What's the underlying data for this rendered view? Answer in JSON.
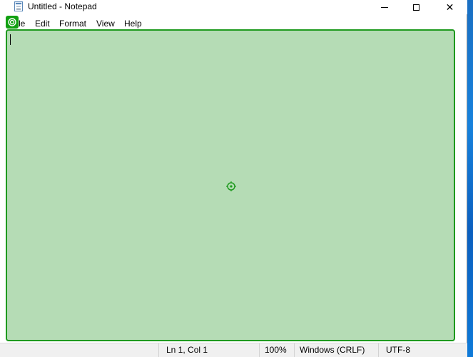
{
  "window": {
    "title": "Untitled - Notepad",
    "icon": "notepad-icon"
  },
  "caption_buttons": {
    "minimize": "minimize-icon",
    "maximize": "maximize-icon",
    "close": "close-icon",
    "close_glyph": "✕"
  },
  "menu": {
    "file": "le",
    "edit": "Edit",
    "format": "Format",
    "view": "View",
    "help": "Help"
  },
  "editor": {
    "text": ""
  },
  "status": {
    "position": "Ln 1, Col 1",
    "zoom": "100%",
    "line_ending": "Windows (CRLF)",
    "encoding": "UTF-8"
  },
  "colors": {
    "highlight_fill": "#b5dcb5",
    "highlight_border": "#1e9a1e",
    "badge": "#11a011",
    "desktop_blue": "#1781dc"
  }
}
